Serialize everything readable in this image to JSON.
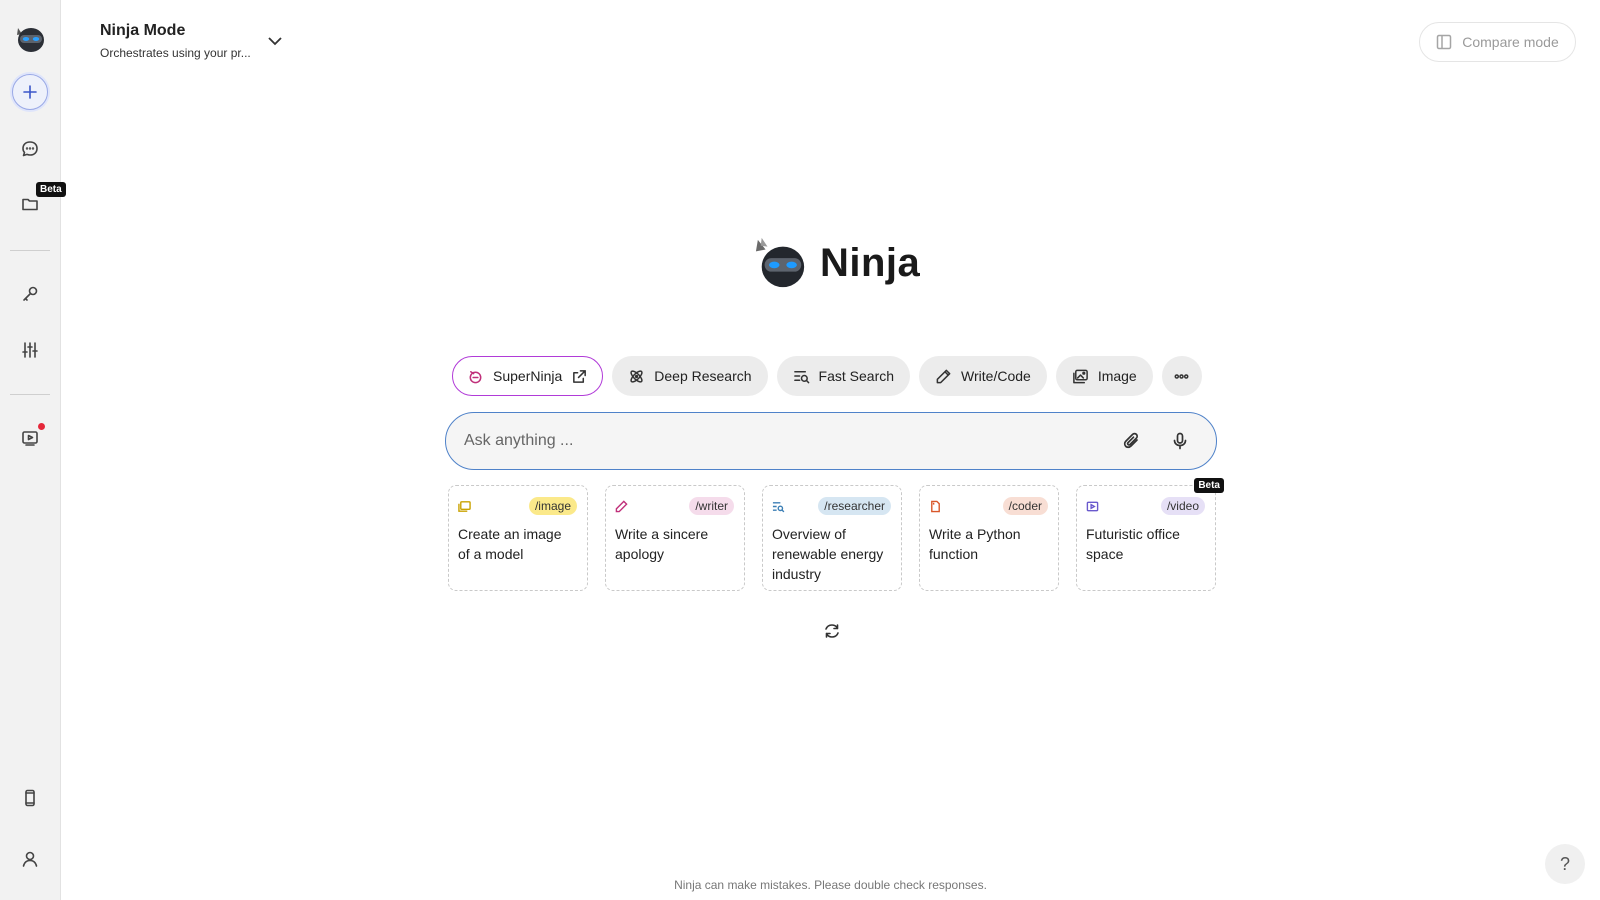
{
  "header": {
    "mode_title": "Ninja Mode",
    "mode_subtitle": "Orchestrates using your pr...",
    "compare_label": "Compare mode"
  },
  "sidebar": {
    "beta_label": "Beta"
  },
  "hero": {
    "name": "Ninja"
  },
  "skills": [
    {
      "label": "SuperNinja",
      "icon": "superninja-icon"
    },
    {
      "label": "Deep Research",
      "icon": "atom-icon"
    },
    {
      "label": "Fast Search",
      "icon": "search-lines-icon"
    },
    {
      "label": "Write/Code",
      "icon": "pencil-icon"
    },
    {
      "label": "Image",
      "icon": "image-icon"
    }
  ],
  "input": {
    "placeholder": "Ask anything ..."
  },
  "cards": [
    {
      "tag": "/image",
      "text": "Create an image of a model",
      "tag_color": "#fbe98a"
    },
    {
      "tag": "/writer",
      "text": "Write a sincere apology",
      "tag_color": "#f5dceb"
    },
    {
      "tag": "/researcher",
      "text": "Overview of renewable energy industry",
      "tag_color": "#d6e6f2"
    },
    {
      "tag": "/coder",
      "text": "Write a Python function",
      "tag_color": "#f8ded4"
    },
    {
      "tag": "/video",
      "text": "Futuristic office space",
      "tag_color": "#e6e0f6",
      "badge": "Beta"
    }
  ],
  "footer": {
    "note": "Ninja can make mistakes. Please double check responses."
  },
  "help": {
    "label": "?"
  }
}
